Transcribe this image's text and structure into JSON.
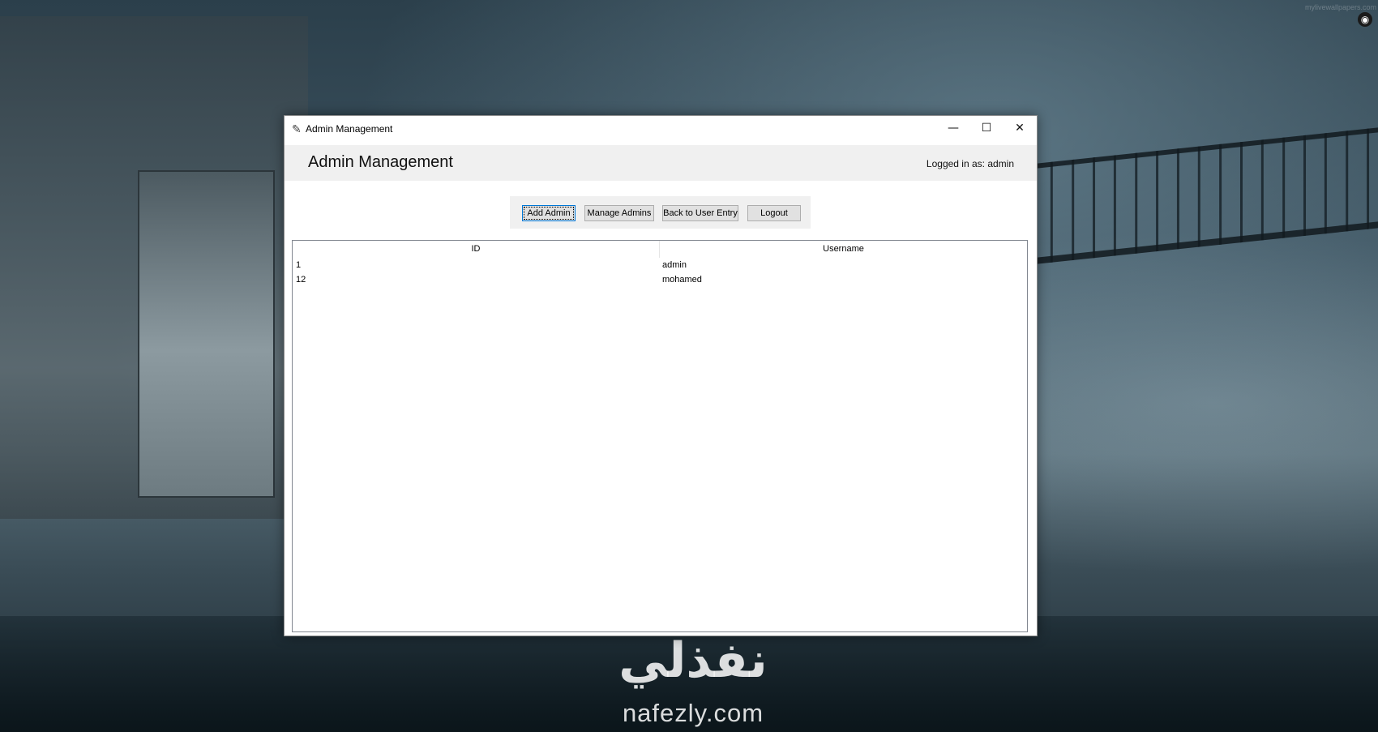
{
  "window": {
    "title": "Admin Management",
    "controls": {
      "minimize": "—",
      "maximize": "☐",
      "close": "✕"
    }
  },
  "header": {
    "title": "Admin Management",
    "logged_in": "Logged in as: admin"
  },
  "toolbar": {
    "add_admin": "Add Admin",
    "manage_admins": "Manage Admins",
    "back_to_user_entry": "Back to User Entry",
    "logout": "Logout"
  },
  "table": {
    "columns": [
      "ID",
      "Username"
    ],
    "rows": [
      {
        "id": "1",
        "username": "admin"
      },
      {
        "id": "12",
        "username": "mohamed"
      }
    ]
  },
  "desktop": {
    "brand_arabic": "نفذلي",
    "brand_latin": "nafezly.com",
    "corner_watermark": "mylivewallpapers.com"
  },
  "icons": {
    "app_icon": "feather-icon",
    "corner_icon": "target-icon"
  }
}
